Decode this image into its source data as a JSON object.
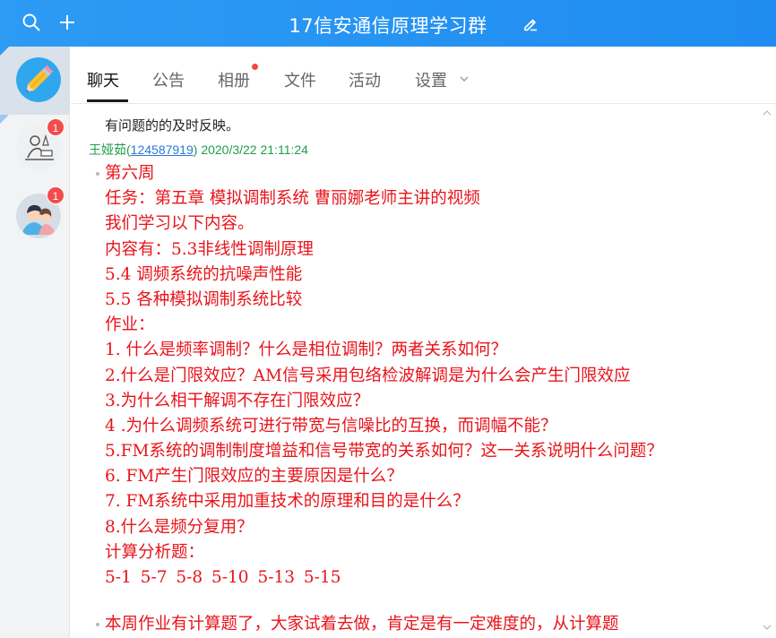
{
  "window": {
    "title": "17信安通信原理学习群",
    "icons": [
      "search-icon",
      "plus-icon",
      "edit-icon"
    ],
    "accent": "#2196f3"
  },
  "sidebar": {
    "conversations": [
      {
        "name": "current-group",
        "icon": "pencil-icon",
        "badge": ""
      },
      {
        "name": "conversation-2",
        "icon": "reading-person-icon",
        "badge": "1"
      },
      {
        "name": "conversation-3",
        "icon": "user-avatar-icon",
        "badge": "1"
      }
    ]
  },
  "tabs": [
    {
      "label": "聊天",
      "active": true
    },
    {
      "label": "公告"
    },
    {
      "label": "相册",
      "dot": true
    },
    {
      "label": "文件"
    },
    {
      "label": "活动"
    },
    {
      "label": "设置"
    }
  ],
  "chat": {
    "previous_text": "有问题的的及时反映。",
    "message": {
      "sender_name": "王娅茹",
      "sender_qq": "124587919",
      "timestamp": "2020/3/22 21:11:24",
      "lines": [
        "第六周",
        "任务：第五章 模拟调制系统  曹丽娜老师主讲的视频",
        "我们学习以下内容。",
        "内容有：5.3非线性调制原理",
        "5.4 调频系统的抗噪声性能",
        "5.5 各种模拟调制系统比较",
        "作业：",
        "1. 什么是频率调制？什么是相位调制？两者关系如何？",
        "2.什么是门限效应？AM信号采用包络检波解调是为什么会产生门限效应",
        "3.为什么相干解调不存在门限效应？",
        "4 .为什么调频系统可进行带宽与信噪比的互换，而调幅不能？",
        "5.FM系统的调制制度增益和信号带宽的关系如何？这一关系说明什么问题？",
        "6. FM产生门限效应的主要原因是什么？",
        "7. FM系统中采用加重技术的原理和目的是什么？",
        "8.什么是频分复用？",
        "计算分析题：",
        "5-1  5-7  5-8  5-10  5-13  5-15"
      ],
      "text_color": "#e8141b"
    },
    "next_message_text": "本周作业有计算题了，大家试着去做，肯定是有一定难度的，从计算题"
  }
}
